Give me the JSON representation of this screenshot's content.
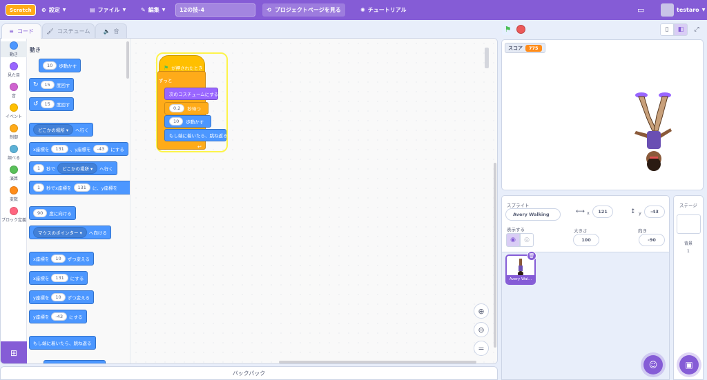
{
  "menu": {
    "logo": "Scratch",
    "settings": "設定",
    "file": "ファイル",
    "edit": "編集",
    "project_title": "12の技-4",
    "project_page": "プロジェクトページを見る",
    "tutorial": "チュートリアル",
    "username": "testaro"
  },
  "tabs": {
    "code": "コード",
    "costume": "コスチューム",
    "sound": "音"
  },
  "categories": [
    {
      "label": "動き",
      "color": "#4c97ff"
    },
    {
      "label": "見た目",
      "color": "#9966ff"
    },
    {
      "label": "音",
      "color": "#cf63cf"
    },
    {
      "label": "イベント",
      "color": "#ffbf00"
    },
    {
      "label": "制御",
      "color": "#ffab19"
    },
    {
      "label": "調べる",
      "color": "#5cb1d6"
    },
    {
      "label": "演算",
      "color": "#59c059"
    },
    {
      "label": "変数",
      "color": "#ff8c1a"
    },
    {
      "label": "ブロック定義",
      "color": "#ff6680"
    }
  ],
  "flyout": {
    "title": "動き",
    "move_steps_val": "10",
    "move_steps_txt": "歩動かす",
    "turn_right_val": "15",
    "turn_right_txt": "度回す",
    "turn_left_val": "15",
    "turn_left_txt": "度回す",
    "goto_dd": "どこかの場所",
    "goto_txt": "へ行く",
    "gotoxy_a": "x座標を",
    "gotoxy_x": "131",
    "gotoxy_b": "、y座標を",
    "gotoxy_y": "-43",
    "gotoxy_c": "にする",
    "glide_sec": "1",
    "glide_a": "秒で",
    "glide_dd": "どこかの場所",
    "glide_b": "へ行く",
    "glidexy_sec": "1",
    "glidexy_a": "秒でx座標を",
    "glidexy_x": "131",
    "glidexy_b": "に、y座標を",
    "point_val": "90",
    "point_txt": "度に向ける",
    "point_towards_dd": "マウスのポインター",
    "point_towards_txt": "へ向ける",
    "change_x_a": "x座標を",
    "change_x_val": "10",
    "change_x_b": "ずつ変える",
    "set_x_a": "x座標を",
    "set_x_val": "131",
    "set_x_b": "にする",
    "change_y_a": "y座標を",
    "change_y_val": "10",
    "change_y_b": "ずつ変える",
    "set_y_a": "y座標を",
    "set_y_val": "-43",
    "set_y_b": "にする",
    "bounce": "もし端に着いたら、跳ね返る"
  },
  "script": {
    "hat": "が押されたとき",
    "forever": "ずっと",
    "next_costume": "次のコスチュームにする",
    "wait_val": "0.2",
    "wait_txt": "秒待つ",
    "move_val": "10",
    "move_txt": "歩動かす",
    "bounce": "もし端に着いたら、跳ね返る"
  },
  "backpack": "バックパック",
  "stage": {
    "score_label": "スコア",
    "score_value": "775"
  },
  "sprite_info": {
    "sprite_label": "スプライト",
    "sprite_name": "Avery Walking",
    "x_label": "x",
    "x_value": "121",
    "y_label": "y",
    "y_value": "-43",
    "show_label": "表示する",
    "size_label": "大きさ",
    "size_value": "100",
    "direction_label": "向き",
    "direction_value": "-90"
  },
  "sprites": [
    {
      "name": "Avery Wal..."
    }
  ],
  "stage_pane": {
    "title": "ステージ",
    "backdrop_label": "背景",
    "backdrop_count": "1"
  },
  "colors": {
    "accent": "#855cd6",
    "motion": "#4c97ff",
    "control": "#ffab19",
    "events": "#ffbf00",
    "looks": "#9966ff"
  }
}
